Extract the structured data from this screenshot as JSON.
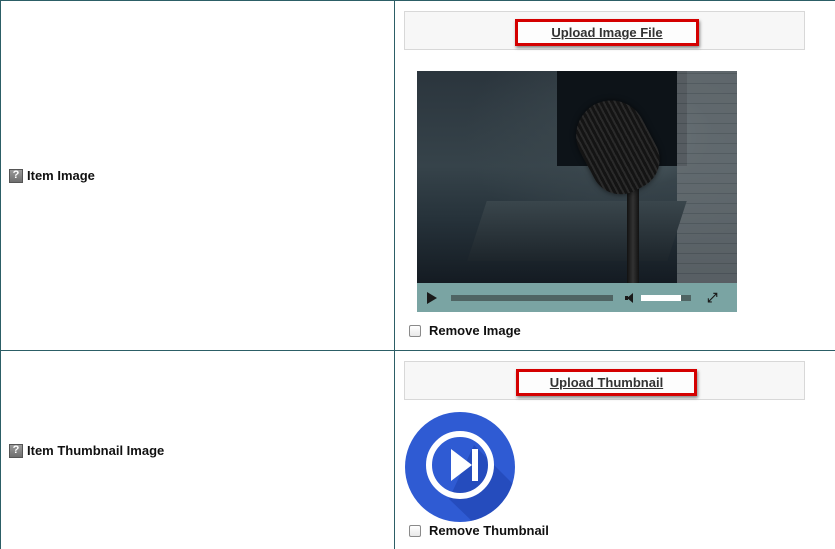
{
  "rows": [
    {
      "label": "Item Image",
      "help_glyph": "?",
      "upload_label": "Upload Image File",
      "remove_label": "Remove Image",
      "video": {
        "volume_level": 0.8,
        "play_icon": "play-icon",
        "volume_icon": "volume-icon",
        "fullscreen_icon": "fullscreen-icon"
      }
    },
    {
      "label": "Item Thumbnail Image",
      "help_glyph": "?",
      "upload_label": "Upload Thumbnail",
      "remove_label": "Remove Thumbnail",
      "thumbnail_icon": "play-next-circle-icon"
    }
  ],
  "colors": {
    "border": "#2c5e66",
    "highlight": "#d40000",
    "thumbnail_blue": "#2f5bd3"
  }
}
